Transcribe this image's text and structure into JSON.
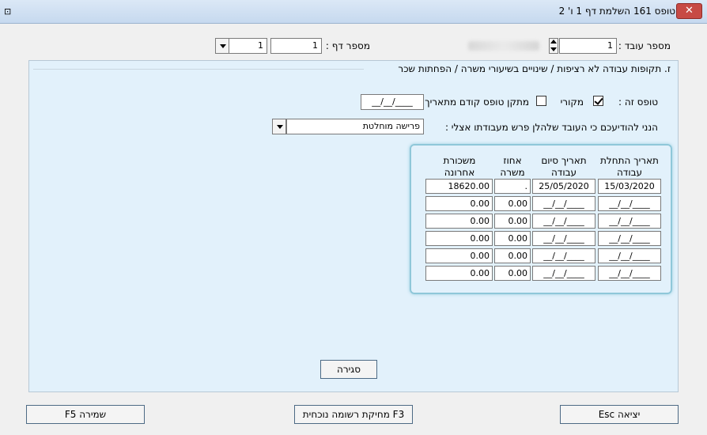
{
  "window": {
    "title": "טופס 161 השלמת דף 1 ו' 2",
    "close_glyph": "✕",
    "app_icon_glyph": "⊡"
  },
  "header": {
    "employee_number_label": "מספר עובד :",
    "employee_number_value": "1",
    "page_number_label": "מספר דף :",
    "page_number_value": "1",
    "page_select_value": "1"
  },
  "section": {
    "title": "ז.  תקופות עבודה לא רציפות / שינויים בשיעורי משרה / הפחתות שכר",
    "form_type_label": "טופס זה :",
    "original_label": "מקורי",
    "original_checked": true,
    "correction_label": "מתקן טופס קודם מתאריך",
    "correction_checked": false,
    "correction_date": "__/__/____",
    "notice_label": "הנני להודיעכם כי העובד שלהלן פרש מעבודתו אצלי :",
    "notice_value": "פרישה מוחלטת"
  },
  "table": {
    "headers": {
      "start_date": [
        "תאריך התחלת",
        "עבודה"
      ],
      "end_date": [
        "תאריך סיום",
        "עבודה"
      ],
      "percent": [
        "אחוז",
        "משרה"
      ],
      "salary": [
        "משכורת",
        "אחרונה"
      ]
    },
    "rows": [
      {
        "start": "15/03/2020",
        "end": "25/05/2020",
        "percent": ".",
        "salary": "18620.00"
      },
      {
        "start": "__/__/____",
        "end": "__/__/____",
        "percent": "0.00",
        "salary": "0.00"
      },
      {
        "start": "__/__/____",
        "end": "__/__/____",
        "percent": "0.00",
        "salary": "0.00"
      },
      {
        "start": "__/__/____",
        "end": "__/__/____",
        "percent": "0.00",
        "salary": "0.00"
      },
      {
        "start": "__/__/____",
        "end": "__/__/____",
        "percent": "0.00",
        "salary": "0.00"
      },
      {
        "start": "__/__/____",
        "end": "__/__/____",
        "percent": "0.00",
        "salary": "0.00"
      }
    ]
  },
  "buttons": {
    "close": "סגירה",
    "exit": "יציאה Esc",
    "delete": "F3  מחיקת רשומה נוכחית",
    "save": "שמירה F5"
  }
}
